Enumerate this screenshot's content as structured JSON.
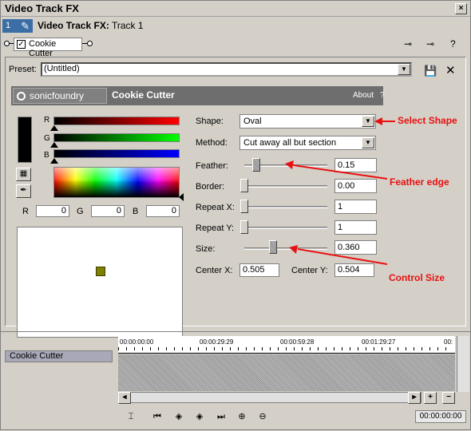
{
  "window": {
    "title": "Video Track FX",
    "close_glyph": "×"
  },
  "track": {
    "number": "1",
    "label_bold": "Video Track FX:",
    "label_name": "Track 1"
  },
  "chain": {
    "plugin_label": "Cookie Cutter",
    "checkmark": "✓"
  },
  "chain_tools": {
    "chain_icon": "chain-icon",
    "remove_icon": "remove-plugin-icon",
    "help_glyph": "?"
  },
  "preset": {
    "label": "Preset:",
    "value": "(Untitled)",
    "save_glyph": "💾",
    "delete_glyph": "✕"
  },
  "header": {
    "logo_text": "sonicfoundry",
    "plugin_name": "Cookie Cutter",
    "about": "About",
    "help": "?"
  },
  "color": {
    "r_letter": "R",
    "g_letter": "G",
    "b_letter": "B",
    "r_value": "0",
    "g_value": "0",
    "b_value": "0",
    "swatch": "#000000"
  },
  "params": {
    "shape_label": "Shape:",
    "shape_value": "Oval",
    "method_label": "Method:",
    "method_value": "Cut away all but section",
    "feather_label": "Feather:",
    "feather_value": "0.15",
    "feather_level": 0.15,
    "border_label": "Border:",
    "border_value": "0.00",
    "border_level": 0,
    "repeatx_label": "Repeat X:",
    "repeatx_value": "1",
    "repeaty_label": "Repeat Y:",
    "repeaty_value": "1",
    "size_label": "Size:",
    "size_value": "0.360",
    "size_level": 0.36,
    "centerx_label": "Center X:",
    "centerx_value": "0.505",
    "centery_label": "Center Y:",
    "centery_value": "0.504"
  },
  "annotations": {
    "shape": "Select Shape",
    "feather": "Feather edge",
    "size": "Control Size"
  },
  "timeline": {
    "track_name": "Cookie Cutter",
    "ticks": [
      "00:00:00:00",
      "00:00:29:29",
      "00:00:59:28",
      "00:01:29:27",
      "00:"
    ],
    "time": "00:00:00:00",
    "zoom_in": "+",
    "zoom_out": "−"
  }
}
